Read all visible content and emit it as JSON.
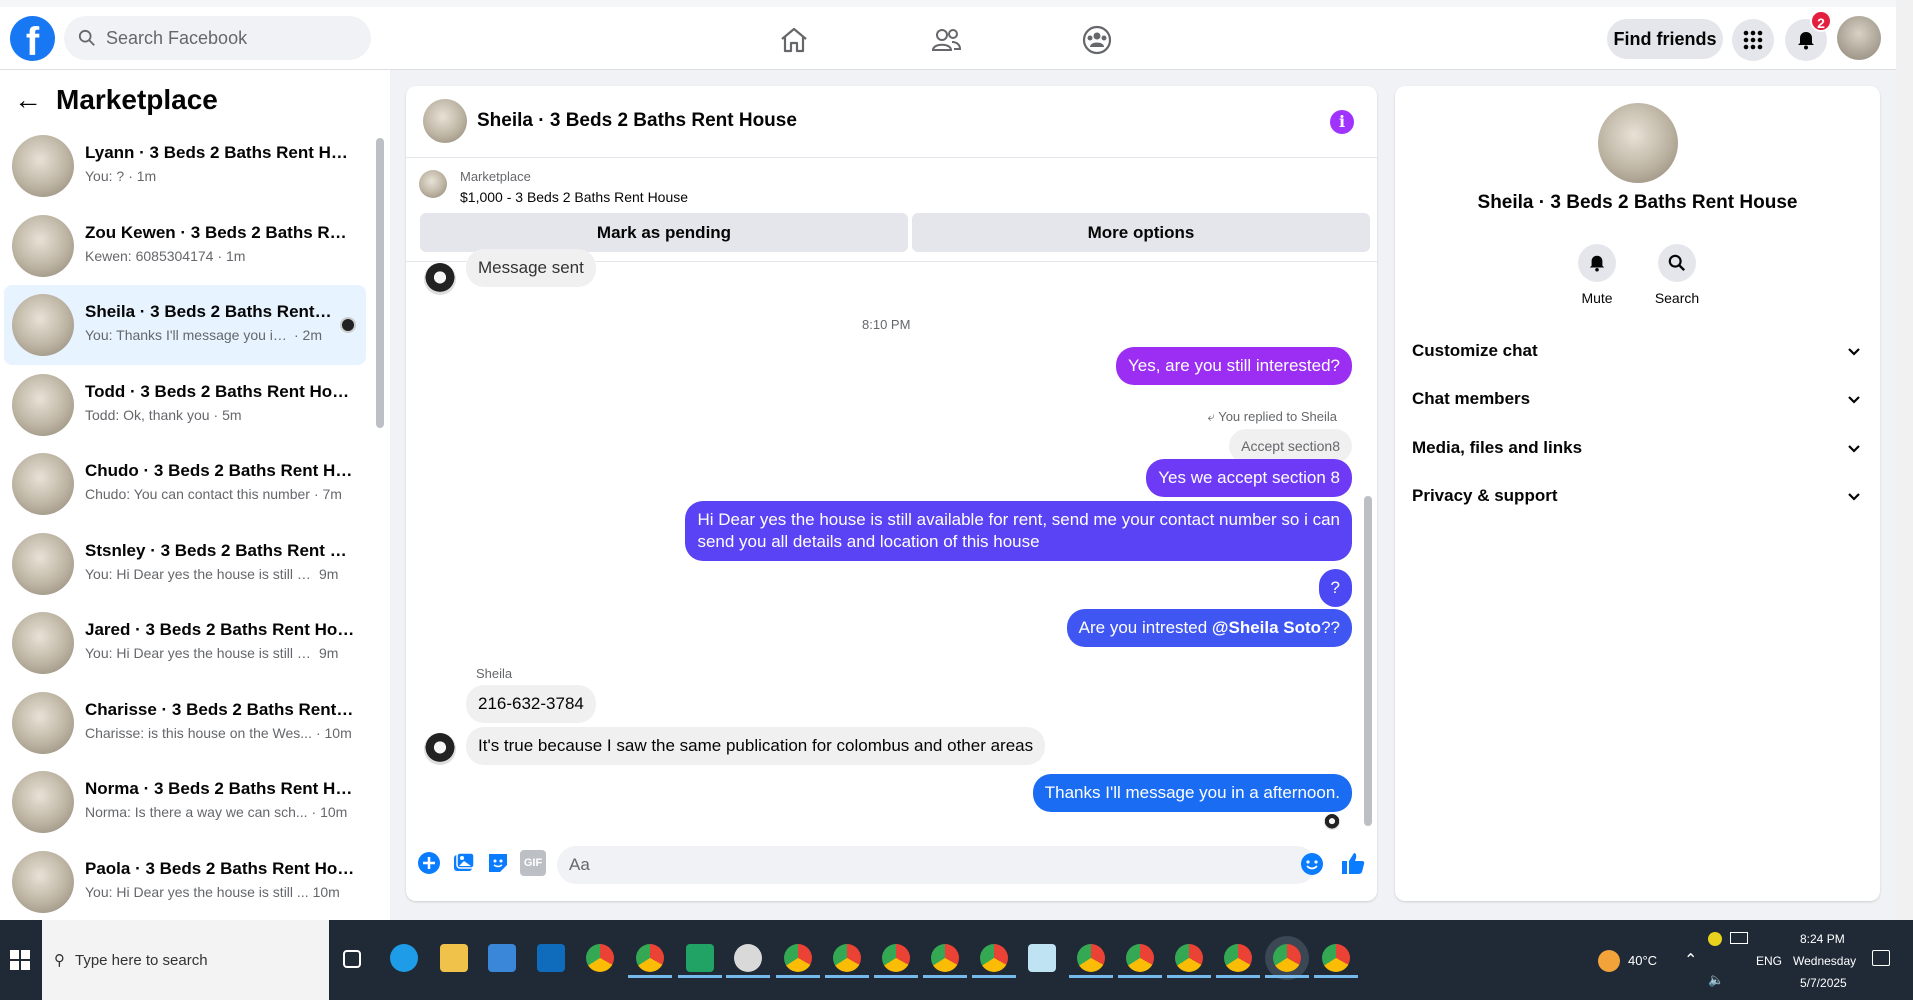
{
  "topbar": {
    "search_placeholder": "Search Facebook",
    "find_friends": "Find friends",
    "notification_count": "2",
    "brand_color": "#1877f2"
  },
  "left": {
    "title": "Marketplace",
    "conversations": [
      {
        "name": "Lyann · 3 Beds 2 Baths Rent House",
        "preview": "You: ?",
        "time": "· 1m"
      },
      {
        "name": "Zou Kewen · 3 Beds 2 Baths Rent...",
        "preview": "Kewen: 6085304174",
        "time": "· 1m"
      },
      {
        "name": "Sheila · 3 Beds 2 Baths Rent H...",
        "preview": "You: Thanks I'll message you in ...",
        "time": "· 2m"
      },
      {
        "name": "Todd · 3 Beds 2 Baths Rent House",
        "preview": "Todd: Ok, thank you",
        "time": "· 5m"
      },
      {
        "name": "Chudo · 3 Beds 2 Baths Rent Ho...",
        "preview": "Chudo: You can contact this number",
        "time": "· 7m"
      },
      {
        "name": "Stsnley · 3 Beds 2 Baths Rent Ho...",
        "preview": "You: Hi Dear yes the house is still a...",
        "time": "9m"
      },
      {
        "name": "Jared · 3 Beds 2 Baths Rent House",
        "preview": "You: Hi Dear yes the house is still a...",
        "time": "9m"
      },
      {
        "name": "Charisse · 3 Beds 2 Baths Rent H...",
        "preview": "Charisse: is this house on the Wes...",
        "time": "· 10m"
      },
      {
        "name": "Norma · 3 Beds 2 Baths Rent Ho...",
        "preview": "Norma: Is there a way we can sch...",
        "time": "· 10m"
      },
      {
        "name": "Paola · 3 Beds 2 Baths Rent House",
        "preview": "You: Hi Dear yes the house is still ...",
        "time": "10m"
      }
    ]
  },
  "chat": {
    "title": "Sheila · 3 Beds 2 Baths Rent House",
    "marketplace_label": "Marketplace",
    "listing": "$1,000 - 3 Beds 2 Baths Rent House",
    "mark_pending": "Mark as pending",
    "more_options": "More options",
    "messages": {
      "partial_top": "Message sent",
      "timestamp": "8:10 PM",
      "m1": "Yes, are you still interested?",
      "replied_to": "You replied to Sheila",
      "quoted": "Accept section8",
      "m2": "Yes we accept section 8",
      "m3_line1": "Hi Dear yes the house is still available for rent, send me your contact number so i can",
      "m3_line2": "send you all details and location of this house",
      "m4": "?",
      "m5_prefix": "Are  you intrested ",
      "m5_mention": "@Sheila Soto",
      "m5_suffix": "??",
      "sender_name": "Sheila",
      "in1": "216-632-3784",
      "in2": "It's true because I saw the same publication for colombus and other areas",
      "m6": "Thanks I'll message you in a afternoon."
    },
    "composer_placeholder": "Aa"
  },
  "right": {
    "title": "Sheila · 3 Beds 2 Baths Rent House",
    "mute": "Mute",
    "search": "Search",
    "sections": [
      "Customize chat",
      "Chat members",
      "Media, files and links",
      "Privacy & support"
    ]
  },
  "taskbar": {
    "search_placeholder": "Type here to search",
    "weather": "40°C",
    "lang": "ENG",
    "time": "8:24 PM",
    "day": "Wednesday",
    "date": "5/7/2025"
  }
}
